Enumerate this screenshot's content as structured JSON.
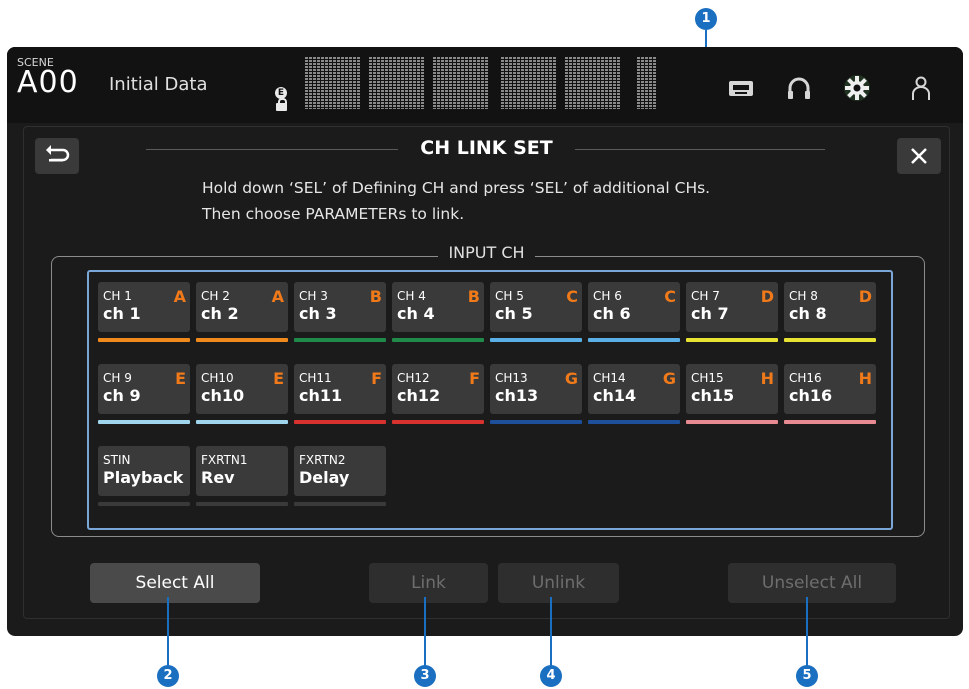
{
  "topbar": {
    "scene_label": "SCENE",
    "scene_number": "A00",
    "scene_name": "Initial Data",
    "edit_badge": "E",
    "icons": [
      "recorder-icon",
      "headphones-icon",
      "gear-icon",
      "user-icon"
    ]
  },
  "dialog": {
    "title": "CH LINK SET",
    "instruction_line1": "Hold down ‘SEL’ of Defining CH and press ‘SEL’ of additional CHs.",
    "instruction_line2": "Then choose PARAMETERs to link.",
    "group_label": "INPUT CH",
    "back_icon": "return-icon",
    "close_label": "×"
  },
  "channels": [
    {
      "id": "CH 1",
      "name": "ch 1",
      "group": "A",
      "color": "#f08a1c"
    },
    {
      "id": "CH 2",
      "name": "ch 2",
      "group": "A",
      "color": "#f08a1c"
    },
    {
      "id": "CH 3",
      "name": "ch 3",
      "group": "B",
      "color": "#1f8a4a"
    },
    {
      "id": "CH 4",
      "name": "ch 4",
      "group": "B",
      "color": "#1f8a4a"
    },
    {
      "id": "CH 5",
      "name": "ch 5",
      "group": "C",
      "color": "#5ab0e6"
    },
    {
      "id": "CH 6",
      "name": "ch 6",
      "group": "C",
      "color": "#5ab0e6"
    },
    {
      "id": "CH 7",
      "name": "ch 7",
      "group": "D",
      "color": "#e8e232"
    },
    {
      "id": "CH 8",
      "name": "ch 8",
      "group": "D",
      "color": "#e8e232"
    },
    {
      "id": "CH 9",
      "name": "ch 9",
      "group": "E",
      "color": "#9fd6ee"
    },
    {
      "id": "CH10",
      "name": "ch10",
      "group": "E",
      "color": "#9fd6ee"
    },
    {
      "id": "CH11",
      "name": "ch11",
      "group": "F",
      "color": "#d8322e"
    },
    {
      "id": "CH12",
      "name": "ch12",
      "group": "F",
      "color": "#d8322e"
    },
    {
      "id": "CH13",
      "name": "ch13",
      "group": "G",
      "color": "#1e4f9a"
    },
    {
      "id": "CH14",
      "name": "ch14",
      "group": "G",
      "color": "#1e4f9a"
    },
    {
      "id": "CH15",
      "name": "ch15",
      "group": "H",
      "color": "#e88a92"
    },
    {
      "id": "CH16",
      "name": "ch16",
      "group": "H",
      "color": "#e88a92"
    },
    {
      "id": "STIN",
      "name": "Playback",
      "group": "",
      "color": "#3a3a3a"
    },
    {
      "id": "FXRTN1",
      "name": "Rev",
      "group": "",
      "color": "#3a3a3a"
    },
    {
      "id": "FXRTN2",
      "name": "Delay",
      "group": "",
      "color": "#3a3a3a"
    }
  ],
  "buttons": {
    "select_all": "Select All",
    "link": "Link",
    "unlink": "Unlink",
    "unselect_all": "Unselect All"
  },
  "callouts": [
    "1",
    "2",
    "3",
    "4",
    "5"
  ],
  "colors": {
    "accent": "#1a6fc0",
    "group_letter": "#f07a1a",
    "selection_frame": "#7aa6d8"
  }
}
